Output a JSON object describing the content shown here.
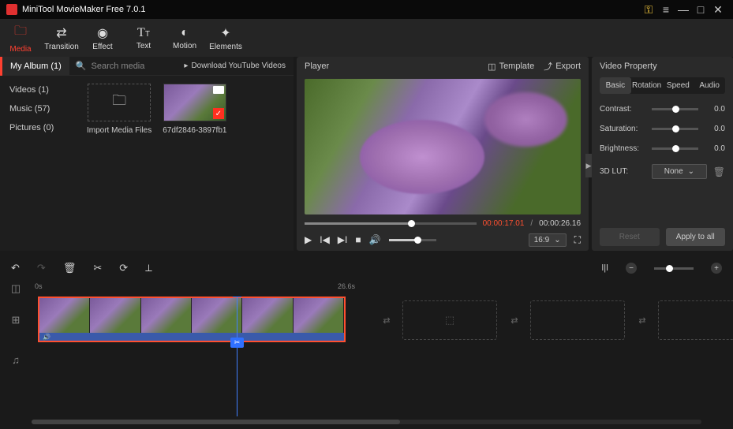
{
  "app": {
    "title": "MiniTool MovieMaker Free 7.0.1"
  },
  "tabs": {
    "media": "Media",
    "transition": "Transition",
    "effect": "Effect",
    "text": "Text",
    "motion": "Motion",
    "elements": "Elements"
  },
  "mediabar": {
    "album": "My Album (1)",
    "search_placeholder": "Search media",
    "youtube": "Download YouTube Videos"
  },
  "cats": {
    "videos": "Videos (1)",
    "music": "Music (57)",
    "pictures": "Pictures (0)"
  },
  "thumbs": {
    "import": "Import Media Files",
    "clip1": "67df2846-3897fb1"
  },
  "player": {
    "title": "Player",
    "template": "Template",
    "export": "Export",
    "time_current": "00:00:17.01",
    "time_total": "00:00:26.16",
    "aspect": "16:9"
  },
  "props": {
    "title": "Video Property",
    "tabs": {
      "basic": "Basic",
      "rotation": "Rotation",
      "speed": "Speed",
      "audio": "Audio"
    },
    "contrast": {
      "label": "Contrast:",
      "value": "0.0"
    },
    "saturation": {
      "label": "Saturation:",
      "value": "0.0"
    },
    "brightness": {
      "label": "Brightness:",
      "value": "0.0"
    },
    "lut": {
      "label": "3D LUT:",
      "value": "None"
    },
    "reset": "Reset",
    "apply": "Apply to all"
  },
  "timeline": {
    "ruler_start": "0s",
    "ruler_mark": "26.6s"
  }
}
